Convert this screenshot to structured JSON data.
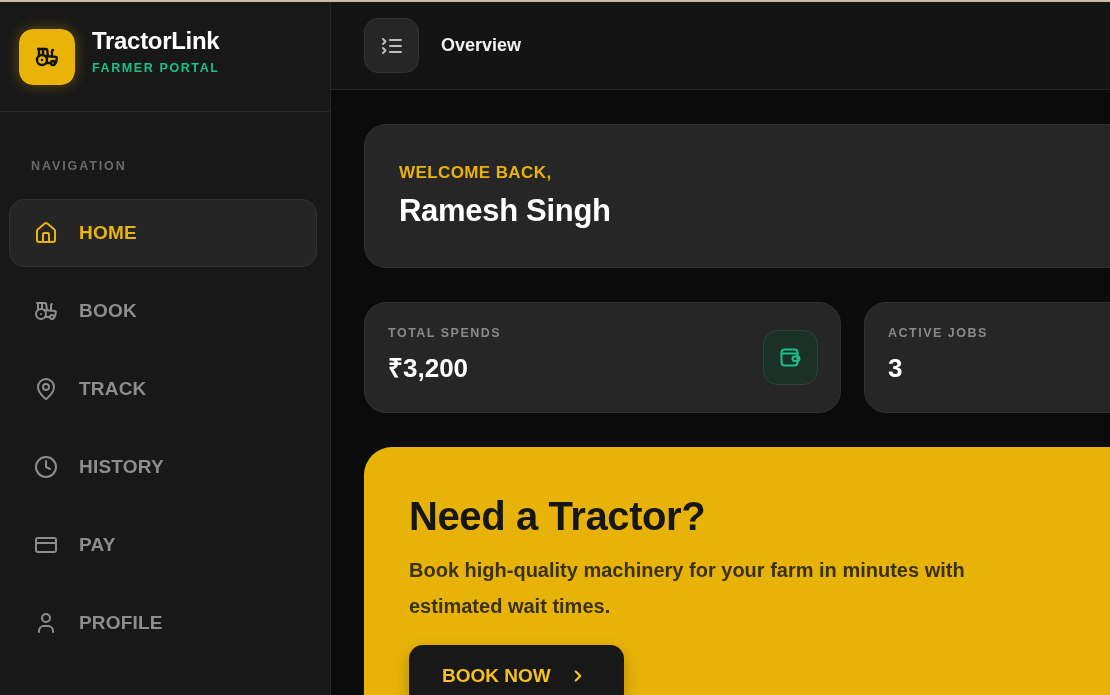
{
  "brand": {
    "name": "TractorLink",
    "tagline": "FARMER PORTAL"
  },
  "sidebar": {
    "heading": "NAVIGATION",
    "items": [
      {
        "label": "HOME",
        "selected": true
      },
      {
        "label": "BOOK",
        "selected": false
      },
      {
        "label": "TRACK",
        "selected": false
      },
      {
        "label": "HISTORY",
        "selected": false
      },
      {
        "label": "PAY",
        "selected": false
      },
      {
        "label": "PROFILE",
        "selected": false
      }
    ]
  },
  "header": {
    "title": "Overview"
  },
  "welcome": {
    "greeting": "WELCOME BACK,",
    "name": "Ramesh Singh"
  },
  "stats": [
    {
      "label": "TOTAL SPENDS",
      "value": "₹3,200"
    },
    {
      "label": "ACTIVE JOBS",
      "value": "3"
    }
  ],
  "banner": {
    "title": "Need a Tractor?",
    "text": "Book high-quality machinery for your farm in minutes with estimated wait times.",
    "button": "BOOK NOW"
  }
}
